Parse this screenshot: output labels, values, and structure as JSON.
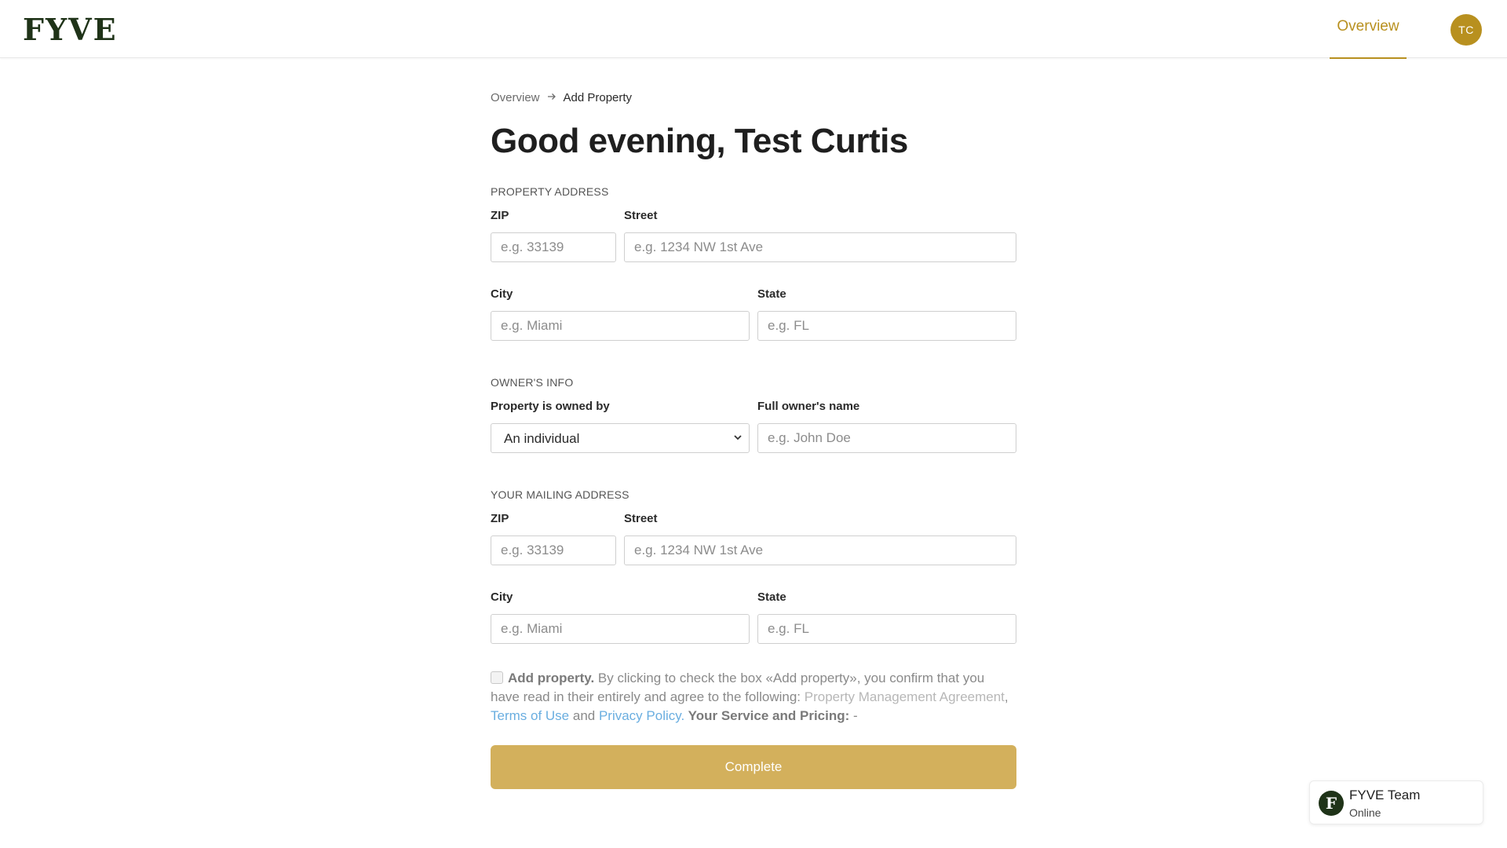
{
  "header": {
    "logo": "FYVE",
    "nav_tab": "Overview",
    "avatar_initials": "TC"
  },
  "breadcrumb": {
    "parent": "Overview",
    "current": "Add Property"
  },
  "title": "Good evening, Test Curtis",
  "property_address": {
    "section_title": "PROPERTY ADDRESS",
    "zip_label": "ZIP",
    "zip_placeholder": "e.g. 33139",
    "street_label": "Street",
    "street_placeholder": "e.g. 1234 NW 1st Ave",
    "city_label": "City",
    "city_placeholder": "e.g. Miami",
    "state_label": "State",
    "state_placeholder": "e.g. FL"
  },
  "owners_info": {
    "section_title": "OWNER'S INFO",
    "owned_by_label": "Property is owned by",
    "owned_by_value": "An individual",
    "owner_name_label": "Full owner's name",
    "owner_name_placeholder": "e.g. John Doe"
  },
  "mailing_address": {
    "section_title": "YOUR MAILING ADDRESS",
    "zip_label": "ZIP",
    "zip_placeholder": "e.g. 33139",
    "street_label": "Street",
    "street_placeholder": "e.g. 1234 NW 1st Ave",
    "city_label": "City",
    "city_placeholder": "e.g. Miami",
    "state_label": "State",
    "state_placeholder": "e.g. FL"
  },
  "terms": {
    "checked": false,
    "bold_lead": "Add property.",
    "text": " By clicking to check the box «Add property», you confirm that you have read in their entirely and agree to the following: ",
    "pma_link": "Property Management Agreement",
    "comma": ", ",
    "terms_link": "Terms of Use",
    "and": " and ",
    "privacy_link": "Privacy Policy.",
    "pricing_label": " Your Service and Pricing:",
    "pricing_value": " -"
  },
  "complete_button": "Complete",
  "chat": {
    "avatar_letter": "F",
    "name": "FYVE Team",
    "status": "Online"
  },
  "colors": {
    "brand_dark_green": "#1f3318",
    "accent_gold": "#b8901f",
    "button_gold": "#d3b05c",
    "link_blue": "#6aaee0"
  }
}
